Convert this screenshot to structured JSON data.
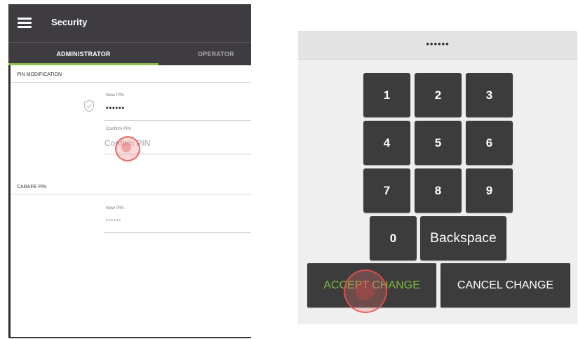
{
  "left": {
    "app_title": "Security",
    "tabs": [
      {
        "label": "ADMINISTRATOR",
        "active": true
      },
      {
        "label": "OPERATOR",
        "active": false
      }
    ],
    "pin_modification": {
      "section_label": "PIN MODIFICATION",
      "new_pin_label": "New PIN",
      "new_pin_value": "••••••",
      "confirm_pin_label": "Confirm PIN",
      "confirm_pin_placeholder": "Confirm PIN"
    },
    "carafe_pin": {
      "section_label": "CARAFE PIN",
      "new_pin_label": "New PIN",
      "new_pin_value": "******"
    }
  },
  "keypad": {
    "display": "••••••",
    "keys": [
      "1",
      "2",
      "3",
      "4",
      "5",
      "6",
      "7",
      "8",
      "9",
      "0"
    ],
    "backspace_label": "Backspace",
    "accept_label": "ACCEPT CHANGE",
    "cancel_label": "CANCEL CHANGE"
  },
  "colors": {
    "appbar": "#3f3c41",
    "tab_indicator": "#8cc04b",
    "key_bg": "#3c3c3c",
    "accept_text": "#7fb544",
    "touch_indicator": "#e65050"
  },
  "icons": [
    "menu-icon",
    "shield-check-icon"
  ]
}
